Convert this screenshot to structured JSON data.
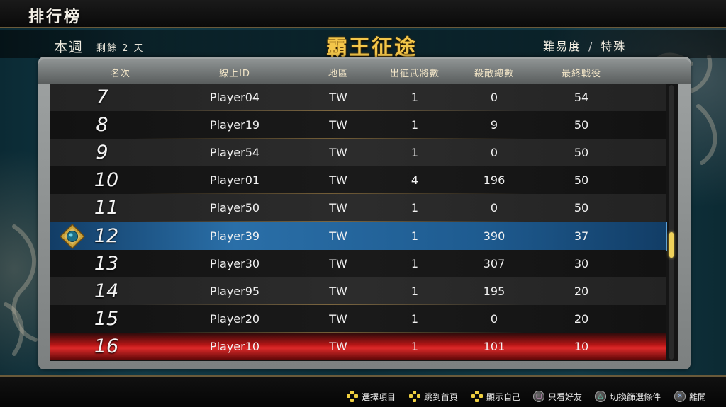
{
  "screen_title": "排行榜",
  "header": {
    "week_label": "本週",
    "remaining": "剩餘 2 天",
    "mode_title": "霸王征途",
    "difficulty_label": "難易度",
    "difficulty_separator": "/",
    "difficulty_value": "特殊"
  },
  "columns": {
    "rank": "名次",
    "online_id": "線上ID",
    "region": "地區",
    "officers": "出征武將數",
    "kills": "殺敵總數",
    "last_battle": "最終戰役"
  },
  "rows": [
    {
      "rank": "7",
      "id": "Player04",
      "region": "TW",
      "officers": "1",
      "kills": "0",
      "last_battle": "54"
    },
    {
      "rank": "8",
      "id": "Player19",
      "region": "TW",
      "officers": "1",
      "kills": "9",
      "last_battle": "50"
    },
    {
      "rank": "9",
      "id": "Player54",
      "region": "TW",
      "officers": "1",
      "kills": "0",
      "last_battle": "50"
    },
    {
      "rank": "10",
      "id": "Player01",
      "region": "TW",
      "officers": "4",
      "kills": "196",
      "last_battle": "50"
    },
    {
      "rank": "11",
      "id": "Player50",
      "region": "TW",
      "officers": "1",
      "kills": "0",
      "last_battle": "50"
    },
    {
      "rank": "12",
      "id": "Player39",
      "region": "TW",
      "officers": "1",
      "kills": "390",
      "last_battle": "37"
    },
    {
      "rank": "13",
      "id": "Player30",
      "region": "TW",
      "officers": "1",
      "kills": "307",
      "last_battle": "30"
    },
    {
      "rank": "14",
      "id": "Player95",
      "region": "TW",
      "officers": "1",
      "kills": "195",
      "last_battle": "20"
    },
    {
      "rank": "15",
      "id": "Player20",
      "region": "TW",
      "officers": "1",
      "kills": "0",
      "last_battle": "20"
    },
    {
      "rank": "16",
      "id": "Player10",
      "region": "TW",
      "officers": "1",
      "kills": "101",
      "last_battle": "10"
    }
  ],
  "selected_rank": "12",
  "hints": {
    "select": "選擇項目",
    "jump_top": "跳到首頁",
    "show_self": "顯示自己",
    "friends_only": "只看好友",
    "switch_filter": "切換篩選條件",
    "leave": "離開"
  },
  "icons": {
    "dpad": "dpad-icon",
    "square": "square-button-icon",
    "triangle": "triangle-button-icon",
    "cross": "cross-button-icon",
    "emblem": "player-emblem-icon"
  },
  "colors": {
    "accent_gold": "#f3c64a",
    "selected_blue": "#2a6fa8",
    "danger_red": "#e02a2a",
    "scroll_thumb": "#f0d25a"
  }
}
